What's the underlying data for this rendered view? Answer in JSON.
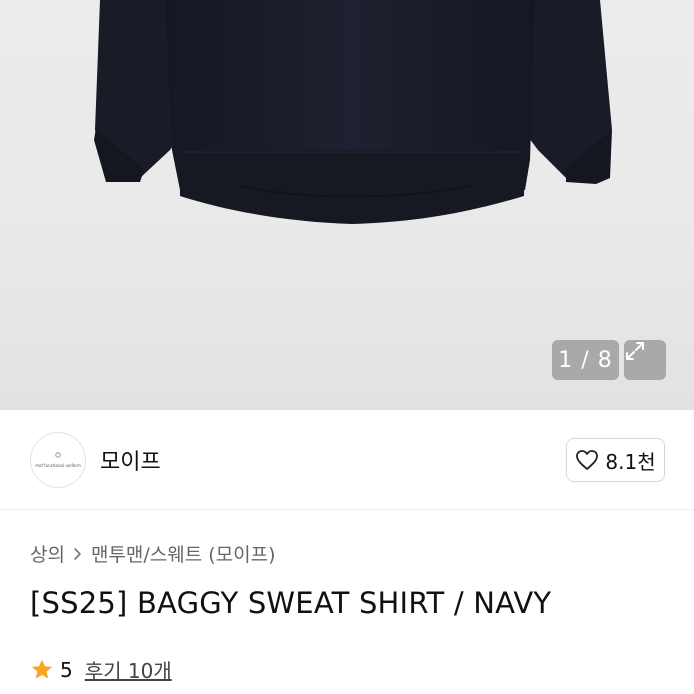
{
  "gallery": {
    "counter": "1 / 8",
    "expand_icon": "expand-icon"
  },
  "seller": {
    "avatar_text": "mof functional uniform",
    "name": "모이프",
    "like_icon": "heart-outline-icon",
    "like_count": "8.1천"
  },
  "breadcrumb": {
    "category": "상의",
    "separator_icon": "chevron-right-icon",
    "subcategory": "맨투맨/스웨트 (모이프)"
  },
  "product": {
    "title": "[SS25] BAGGY SWEAT SHIRT / NAVY"
  },
  "rating": {
    "star_icon": "star-icon",
    "score": "5",
    "reviews_label": "후기 10개"
  },
  "colors": {
    "star": "#F5A623",
    "garment": "#1b1d28"
  }
}
